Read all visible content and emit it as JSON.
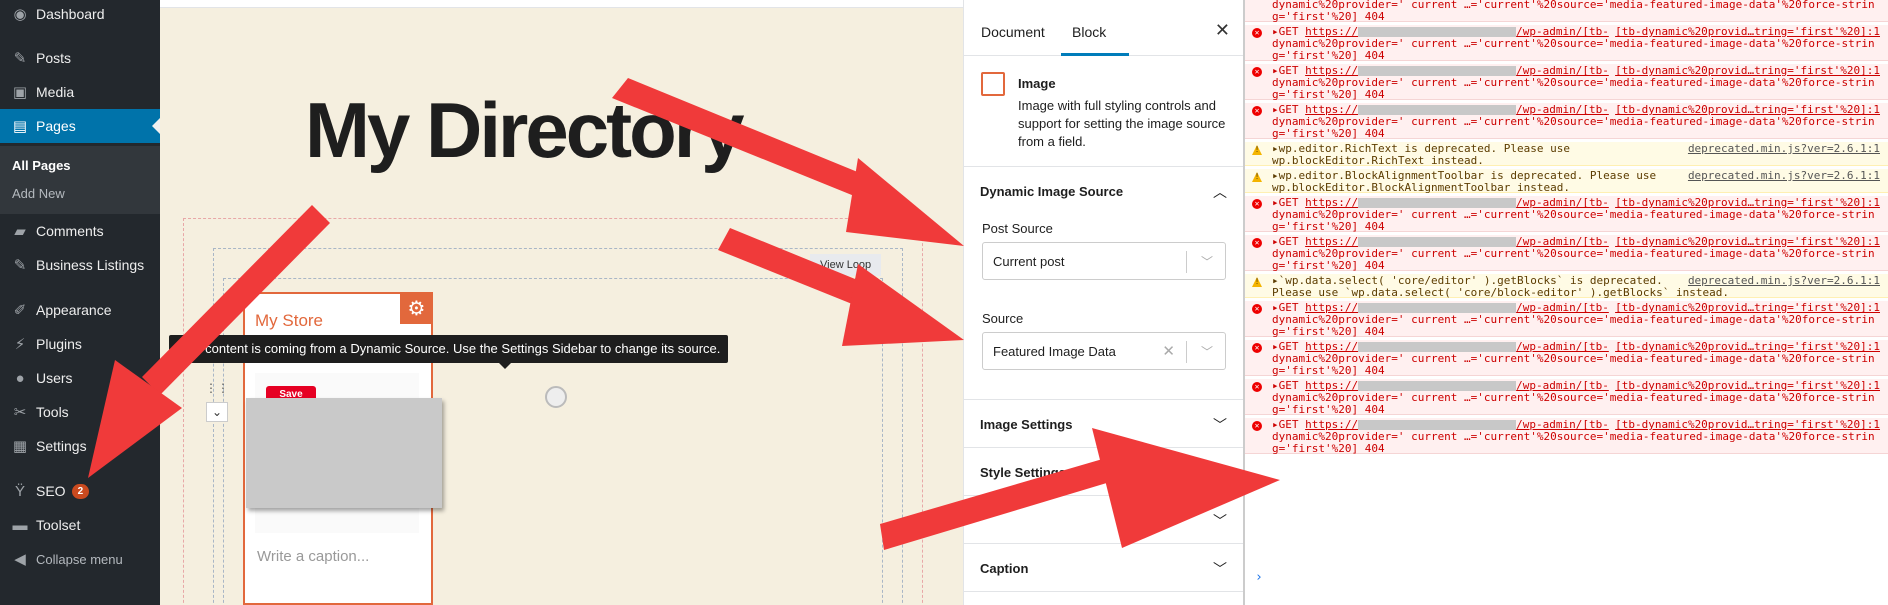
{
  "wp_menu": {
    "items": [
      {
        "label": "Dashboard",
        "icon": "dashboard-icon",
        "glyph": "◉"
      },
      {
        "label": "Posts",
        "icon": "pin-icon",
        "glyph": "✎"
      },
      {
        "label": "Media",
        "icon": "media-icon",
        "glyph": "▣"
      },
      {
        "label": "Pages",
        "icon": "pages-icon",
        "glyph": "▤"
      },
      {
        "label": "Comments",
        "icon": "comments-icon",
        "glyph": "▰"
      },
      {
        "label": "Business Listings",
        "icon": "listings-icon",
        "glyph": "✎"
      },
      {
        "label": "Appearance",
        "icon": "brush-icon",
        "glyph": "✐"
      },
      {
        "label": "Plugins",
        "icon": "plugin-icon",
        "glyph": "⚡"
      },
      {
        "label": "Users",
        "icon": "user-icon",
        "glyph": "●"
      },
      {
        "label": "Tools",
        "icon": "wrench-icon",
        "glyph": "✂"
      },
      {
        "label": "Settings",
        "icon": "settings-icon",
        "glyph": "▦"
      },
      {
        "label": "SEO",
        "icon": "yoast-icon",
        "glyph": "Ÿ",
        "badge": "2"
      },
      {
        "label": "Toolset",
        "icon": "toolset-icon",
        "glyph": "▬"
      },
      {
        "label": "Collapse menu",
        "icon": "collapse-icon",
        "glyph": "◀"
      }
    ],
    "submenu": [
      "All Pages",
      "Add New"
    ]
  },
  "editor": {
    "page_title": "My Directory",
    "view_loop": "View Loop",
    "block_label": "My Store",
    "save_button": "Save",
    "caption_placeholder": "Write a caption...",
    "tooltip": "This content is coming from a Dynamic Source. Use the Settings Sidebar to change its source."
  },
  "settings": {
    "tabs": [
      "Document",
      "Block"
    ],
    "block_title": "Image",
    "block_desc": "Image with full styling controls and support for setting the image source from a field.",
    "dynamic_panel_title": "Dynamic Image Source",
    "post_source_label": "Post Source",
    "post_source_value": "Current post",
    "source_label": "Source",
    "source_value": "Featured Image Data",
    "panels": [
      "Image Settings",
      "Style Settings",
      "Caption"
    ]
  },
  "console": {
    "rows": [
      {
        "type": "error",
        "l1a": "dynamic%20provider='  current …='current'%20source='media-featured-image-data'%20force-strin",
        "l2": "g='first'%20]",
        "status": "404",
        "top": true
      },
      {
        "type": "error",
        "url": "https://",
        "path": "/wp-admin/[tb-",
        "src": "[tb-dynamic%20provid…tring='first'%20]:1",
        "l1a": "dynamic%20provider='  current …='current'%20source='media-featured-image-data'%20force-strin",
        "l2": "g='first'%20]",
        "status": "404"
      },
      {
        "type": "error",
        "url": "https://",
        "path": "/wp-admin/[tb-",
        "src": "[tb-dynamic%20provid…tring='first'%20]:1",
        "l1a": "dynamic%20provider='  current …='current'%20source='media-featured-image-data'%20force-strin",
        "l2": "g='first'%20]",
        "status": "404"
      },
      {
        "type": "error",
        "url": "https://",
        "path": "/wp-admin/[tb-",
        "src": "[tb-dynamic%20provid…tring='first'%20]:1",
        "l1a": "dynamic%20provider='  current …='current'%20source='media-featured-image-data'%20force-strin",
        "l2": "g='first'%20]",
        "status": "404"
      },
      {
        "type": "warn",
        "text": "wp.editor.RichText is deprecated. Please use",
        "src": "deprecated.min.js?ver=2.6.1:1",
        "l2": "wp.blockEditor.RichText instead."
      },
      {
        "type": "warn",
        "text": "wp.editor.BlockAlignmentToolbar is deprecated. Please use",
        "src": "deprecated.min.js?ver=2.6.1:1",
        "l2": "wp.blockEditor.BlockAlignmentToolbar instead."
      },
      {
        "type": "error",
        "url": "https://",
        "path": "/wp-admin/[tb-",
        "src": "[tb-dynamic%20provid…tring='first'%20]:1",
        "l1a": "dynamic%20provider='  current …='current'%20source='media-featured-image-data'%20force-strin",
        "l2": "g='first'%20]",
        "status": "404"
      },
      {
        "type": "error",
        "url": "https://",
        "path": "/wp-admin/[tb-",
        "src": "[tb-dynamic%20provid…tring='first'%20]:1",
        "l1a": "dynamic%20provider='  current …='current'%20source='media-featured-image-data'%20force-strin",
        "l2": "g='first'%20]",
        "status": "404"
      },
      {
        "type": "warn",
        "text": "`wp.data.select( 'core/editor' ).getBlocks` is deprecated.",
        "src": "deprecated.min.js?ver=2.6.1:1",
        "l2": "Please use `wp.data.select( 'core/block-editor' ).getBlocks` instead."
      },
      {
        "type": "error",
        "url": "https://",
        "path": "/wp-admin/[tb-",
        "src": "[tb-dynamic%20provid…tring='first'%20]:1",
        "l1a": "dynamic%20provider='  current …='current'%20source='media-featured-image-data'%20force-strin",
        "l2": "g='first'%20]",
        "status": "404"
      },
      {
        "type": "error",
        "url": "https://",
        "path": "/wp-admin/[tb-",
        "src": "[tb-dynamic%20provid…tring='first'%20]:1",
        "l1a": "dynamic%20provider='  current …='current'%20source='media-featured-image-data'%20force-strin",
        "l2": "g='first'%20]",
        "status": "404"
      },
      {
        "type": "error",
        "url": "https://",
        "path": "/wp-admin/[tb-",
        "src": "[tb-dynamic%20provid…tring='first'%20]:1",
        "l1a": "dynamic%20provider='  current …='current'%20source='media-featured-image-data'%20force-strin",
        "l2": "g='first'%20]",
        "status": "404"
      },
      {
        "type": "error",
        "url": "https://",
        "path": "/wp-admin/[tb-",
        "src": "[tb-dynamic%20provid…tring='first'%20]:1",
        "l1a": "dynamic%20provider='  current …='current'%20source='media-featured-image-data'%20force-strin",
        "l2": "g='first'%20]",
        "status": "404"
      }
    ],
    "prompt": "›"
  },
  "colors": {
    "accent": "#0073aa",
    "block_accent": "#e2683c",
    "arrow": "#f03a3a",
    "error": "#cc0000"
  }
}
